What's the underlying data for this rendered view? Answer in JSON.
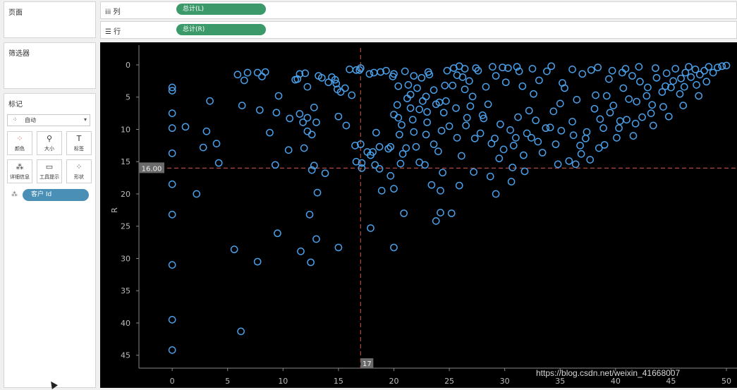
{
  "panels": {
    "pages_title": "页面",
    "filters_title": "筛选器",
    "marks_title": "标记"
  },
  "shelves": {
    "columns_label": "列",
    "columns_pill": "总计(L)",
    "rows_label": "行",
    "rows_pill": "总计(R)"
  },
  "marks": {
    "type_selected": "自动",
    "buttons": [
      {
        "label": "颜色",
        "icon": "color-icon"
      },
      {
        "label": "大小",
        "icon": "size-icon"
      },
      {
        "label": "标签",
        "icon": "label-icon"
      },
      {
        "label": "详细信息",
        "icon": "detail-icon"
      },
      {
        "label": "工具提示",
        "icon": "tooltip-icon"
      },
      {
        "label": "形状",
        "icon": "shape-icon"
      }
    ],
    "detail_pill": "客户 Id"
  },
  "watermark": "https://blog.csdn.net/weixin_41668007",
  "chart_data": {
    "type": "scatter",
    "ylabel": "R",
    "xlabel": "",
    "xlim": [
      -3,
      50
    ],
    "ylim": [
      0,
      47
    ],
    "y_reversed": true,
    "x_ticks": [
      0,
      5,
      10,
      15,
      20,
      25,
      30,
      35,
      40,
      45,
      50
    ],
    "y_ticks": [
      0,
      5,
      10,
      15,
      20,
      25,
      30,
      35,
      40,
      45
    ],
    "reference_lines": {
      "x": {
        "value": 17,
        "label": "17"
      },
      "y": {
        "value": 16.0,
        "label": "16.00"
      }
    },
    "marker": "circle-open",
    "color": "#4a9fe8",
    "points": [
      [
        0,
        3.5
      ],
      [
        0,
        4
      ],
      [
        0,
        7.5
      ],
      [
        0,
        9.8
      ],
      [
        0,
        13.7
      ],
      [
        0,
        18.5
      ],
      [
        0,
        23.2
      ],
      [
        0,
        31
      ],
      [
        0,
        39.5
      ],
      [
        0,
        44.2
      ],
      [
        1.2,
        9.6
      ],
      [
        2.2,
        20
      ],
      [
        2.8,
        12.8
      ],
      [
        3.1,
        10.3
      ],
      [
        3.4,
        5.6
      ],
      [
        4,
        12.2
      ],
      [
        4.2,
        15.2
      ],
      [
        5.6,
        28.6
      ],
      [
        5.9,
        1.5
      ],
      [
        6.2,
        41.3
      ],
      [
        6.3,
        6.3
      ],
      [
        6.5,
        2.4
      ],
      [
        6.8,
        1.2
      ],
      [
        7.7,
        1.2
      ],
      [
        7.9,
        7
      ],
      [
        7.7,
        30.5
      ],
      [
        8.1,
        1.8
      ],
      [
        8.4,
        1.1
      ],
      [
        8.8,
        10.5
      ],
      [
        9.3,
        15.5
      ],
      [
        9.4,
        7.4
      ],
      [
        9.5,
        26.1
      ],
      [
        9.6,
        4.8
      ],
      [
        10.5,
        13.2
      ],
      [
        10.6,
        8.3
      ],
      [
        11.1,
        2.3
      ],
      [
        11.3,
        2.2
      ],
      [
        11.5,
        1.4
      ],
      [
        11.5,
        7.6
      ],
      [
        11.6,
        28.9
      ],
      [
        11.8,
        8.9
      ],
      [
        11.9,
        12.9
      ],
      [
        12,
        1.3
      ],
      [
        12.2,
        3.4
      ],
      [
        12.2,
        8.2
      ],
      [
        12.2,
        10.3
      ],
      [
        12.4,
        23.2
      ],
      [
        12.5,
        30.6
      ],
      [
        12.6,
        16.3
      ],
      [
        12.8,
        15.6
      ],
      [
        12.6,
        10.8
      ],
      [
        12.8,
        6.6
      ],
      [
        13,
        8.9
      ],
      [
        13.1,
        19.8
      ],
      [
        13,
        27
      ],
      [
        13.2,
        1.7
      ],
      [
        13.5,
        2
      ],
      [
        13.8,
        16.8
      ],
      [
        14.1,
        2.7
      ],
      [
        14.4,
        1.9
      ],
      [
        14.7,
        2.3
      ],
      [
        14.8,
        2.9
      ],
      [
        14.9,
        3.8
      ],
      [
        15,
        8
      ],
      [
        15.2,
        4.2
      ],
      [
        15,
        28.3
      ],
      [
        15.6,
        3.6
      ],
      [
        15.7,
        9.4
      ],
      [
        16,
        0.7
      ],
      [
        16.2,
        4.7
      ],
      [
        16.5,
        12.5
      ],
      [
        16.6,
        15
      ],
      [
        16.6,
        0.8
      ],
      [
        16.9,
        0.8
      ],
      [
        17,
        0.5
      ],
      [
        17,
        12.3
      ],
      [
        17.1,
        15.2
      ],
      [
        17.1,
        16
      ],
      [
        17.6,
        13.5
      ],
      [
        17.8,
        1.4
      ],
      [
        17.9,
        14
      ],
      [
        18.1,
        13.5
      ],
      [
        17.9,
        25.3
      ],
      [
        18.2,
        1.2
      ],
      [
        18.3,
        15.5
      ],
      [
        18.4,
        10.5
      ],
      [
        18.7,
        12.7
      ],
      [
        18.8,
        1.1
      ],
      [
        18.9,
        19.5
      ],
      [
        19.3,
        0.9
      ],
      [
        19.5,
        13
      ],
      [
        19.7,
        12.7
      ],
      [
        19.9,
        1.8
      ],
      [
        20,
        28.3
      ],
      [
        20,
        19.2
      ],
      [
        20,
        1.4
      ],
      [
        20,
        7.7
      ],
      [
        20.3,
        6.2
      ],
      [
        20.4,
        8.2
      ],
      [
        20.5,
        10.8
      ],
      [
        20.7,
        9.3
      ],
      [
        20.8,
        13.8
      ],
      [
        20.9,
        23
      ],
      [
        21,
        1
      ],
      [
        21.3,
        3.1
      ],
      [
        21.5,
        4.6
      ],
      [
        21.8,
        10.4
      ],
      [
        21.8,
        1.7
      ],
      [
        22,
        12.7
      ],
      [
        22.3,
        15.1
      ],
      [
        22.5,
        2
      ],
      [
        22.6,
        5.6
      ],
      [
        22.8,
        15.5
      ],
      [
        23,
        7.3
      ],
      [
        23,
        8.9
      ],
      [
        23.2,
        1.5
      ],
      [
        23.4,
        18.6
      ],
      [
        23.6,
        3.9
      ],
      [
        23.8,
        24.2
      ],
      [
        24,
        13.4
      ],
      [
        24.2,
        19.5
      ],
      [
        24.2,
        22.9
      ],
      [
        24.4,
        16.7
      ],
      [
        24.6,
        3.2
      ],
      [
        24.5,
        7.4
      ],
      [
        24.8,
        0.9
      ],
      [
        25.2,
        23
      ],
      [
        25.4,
        0.5
      ],
      [
        25.7,
        1.6
      ],
      [
        25.9,
        18.7
      ],
      [
        26.1,
        14.1
      ],
      [
        26.4,
        3.8
      ],
      [
        26.6,
        8.2
      ],
      [
        26.8,
        2.5
      ],
      [
        27.2,
        16.6
      ],
      [
        27.6,
        0.9
      ],
      [
        27.8,
        10.6
      ],
      [
        28.1,
        8.3
      ],
      [
        28.5,
        6.1
      ],
      [
        28.7,
        17.3
      ],
      [
        29.2,
        20
      ],
      [
        29.5,
        14.5
      ],
      [
        29.9,
        13.1
      ],
      [
        30.3,
        0.5
      ],
      [
        30.6,
        18.1
      ],
      [
        30.7,
        15.9
      ],
      [
        31,
        11.3
      ],
      [
        31.3,
        1
      ],
      [
        31.7,
        14
      ],
      [
        32,
        10.6
      ],
      [
        32.2,
        7.1
      ],
      [
        32.6,
        4.5
      ],
      [
        33,
        11.9
      ],
      [
        33.4,
        13.6
      ],
      [
        33.8,
        1
      ],
      [
        34.1,
        9.7
      ],
      [
        34.6,
        12.3
      ],
      [
        35,
        6
      ],
      [
        35.4,
        3.6
      ],
      [
        35.8,
        14.9
      ],
      [
        36.1,
        8.8
      ],
      [
        36.4,
        15.4
      ],
      [
        36.8,
        12.5
      ],
      [
        37,
        1.4
      ],
      [
        37.4,
        10.4
      ],
      [
        37.7,
        14.7
      ],
      [
        38.2,
        4.7
      ],
      [
        38.6,
        8.4
      ],
      [
        39,
        12.4
      ],
      [
        39.4,
        2.2
      ],
      [
        39.8,
        6.3
      ],
      [
        40.3,
        9.8
      ],
      [
        40.7,
        3.6
      ],
      [
        41,
        8.5
      ],
      [
        41.5,
        1.7
      ],
      [
        41.9,
        5.7
      ],
      [
        42.4,
        8.1
      ],
      [
        42.9,
        3.5
      ],
      [
        43.3,
        6.2
      ],
      [
        43.7,
        2
      ],
      [
        44.2,
        4.2
      ],
      [
        44.6,
        1.3
      ],
      [
        45,
        3.5
      ],
      [
        45.4,
        0.6
      ],
      [
        45.9,
        2.1
      ],
      [
        46.3,
        1.2
      ],
      [
        46.8,
        1.9
      ],
      [
        47.2,
        0.7
      ],
      [
        47.6,
        1.5
      ],
      [
        48,
        0.9
      ],
      [
        48.4,
        0.3
      ],
      [
        48.8,
        1.2
      ],
      [
        49.2,
        0.4
      ],
      [
        49.6,
        0.2
      ],
      [
        50,
        0.1
      ],
      [
        44.3,
        6.5
      ],
      [
        46.2,
        3.4
      ],
      [
        43.2,
        7.5
      ],
      [
        41.8,
        9.1
      ],
      [
        40.1,
        11.3
      ],
      [
        38.5,
        12.9
      ],
      [
        36.9,
        13.8
      ],
      [
        34.8,
        15.4
      ],
      [
        31.8,
        16.5
      ],
      [
        30.8,
        12.5
      ],
      [
        28.8,
        12.2
      ],
      [
        27.3,
        11.4
      ],
      [
        26.5,
        9.4
      ],
      [
        25.7,
        11.3
      ],
      [
        25,
        9.5
      ],
      [
        24.3,
        10.2
      ],
      [
        23.6,
        12.3
      ],
      [
        22.9,
        10.8
      ],
      [
        22.3,
        6.9
      ],
      [
        21.7,
        8.5
      ],
      [
        21.1,
        12.9
      ],
      [
        20.6,
        15.3
      ],
      [
        19.7,
        17.2
      ],
      [
        18.7,
        16.1
      ],
      [
        35.2,
        2.8
      ],
      [
        37.8,
        0.8
      ],
      [
        39.2,
        4.8
      ],
      [
        40.6,
        1.2
      ],
      [
        42.2,
        2.6
      ],
      [
        43.6,
        0.5
      ],
      [
        45.2,
        2.5
      ],
      [
        46.6,
        0.3
      ],
      [
        33.1,
        2.4
      ],
      [
        31.6,
        3.3
      ],
      [
        30.1,
        2.7
      ],
      [
        29.2,
        1.7
      ],
      [
        28.3,
        3.4
      ],
      [
        27.1,
        4.9
      ],
      [
        26.2,
        1.9
      ],
      [
        25.3,
        3.2
      ],
      [
        24.1,
        5.8
      ],
      [
        23.1,
        1.1
      ],
      [
        22.1,
        3.6
      ],
      [
        21.2,
        5.2
      ],
      [
        20.4,
        3.3
      ],
      [
        36.5,
        5.4
      ],
      [
        38.1,
        6.8
      ],
      [
        39.5,
        7.4
      ],
      [
        41.2,
        5.3
      ],
      [
        42.8,
        4.8
      ],
      [
        44.5,
        3.3
      ],
      [
        45.8,
        4.5
      ],
      [
        47.3,
        3.1
      ],
      [
        48.2,
        2.6
      ],
      [
        34.4,
        7.2
      ],
      [
        32.8,
        8.6
      ],
      [
        31.2,
        8.1
      ],
      [
        29.6,
        9.2
      ],
      [
        28,
        7.8
      ],
      [
        26.9,
        6.4
      ],
      [
        25.6,
        6.7
      ],
      [
        24.7,
        5.6
      ],
      [
        23.8,
        6.1
      ],
      [
        22.9,
        4.9
      ],
      [
        21.5,
        6.7
      ],
      [
        37.3,
        11.4
      ],
      [
        36.2,
        10.9
      ],
      [
        35.1,
        10.2
      ],
      [
        33.7,
        9.8
      ],
      [
        32.4,
        11.3
      ],
      [
        30.5,
        10.1
      ],
      [
        29.1,
        11.4
      ],
      [
        38.9,
        9.8
      ],
      [
        40.4,
        8.7
      ],
      [
        41.6,
        11
      ],
      [
        43.4,
        9.4
      ],
      [
        44.8,
        8
      ],
      [
        46.1,
        6.3
      ],
      [
        47.5,
        4.8
      ],
      [
        42.1,
        0.3
      ],
      [
        40.9,
        0.6
      ],
      [
        39.7,
        0.9
      ],
      [
        38.4,
        0.4
      ],
      [
        36.1,
        0.7
      ],
      [
        34.2,
        0.2
      ],
      [
        32.5,
        0.6
      ],
      [
        31.1,
        0.3
      ],
      [
        29.8,
        0.4
      ],
      [
        28.9,
        0.3
      ],
      [
        27.4,
        0.5
      ],
      [
        26.4,
        0.6
      ],
      [
        25.9,
        0.2
      ]
    ]
  }
}
